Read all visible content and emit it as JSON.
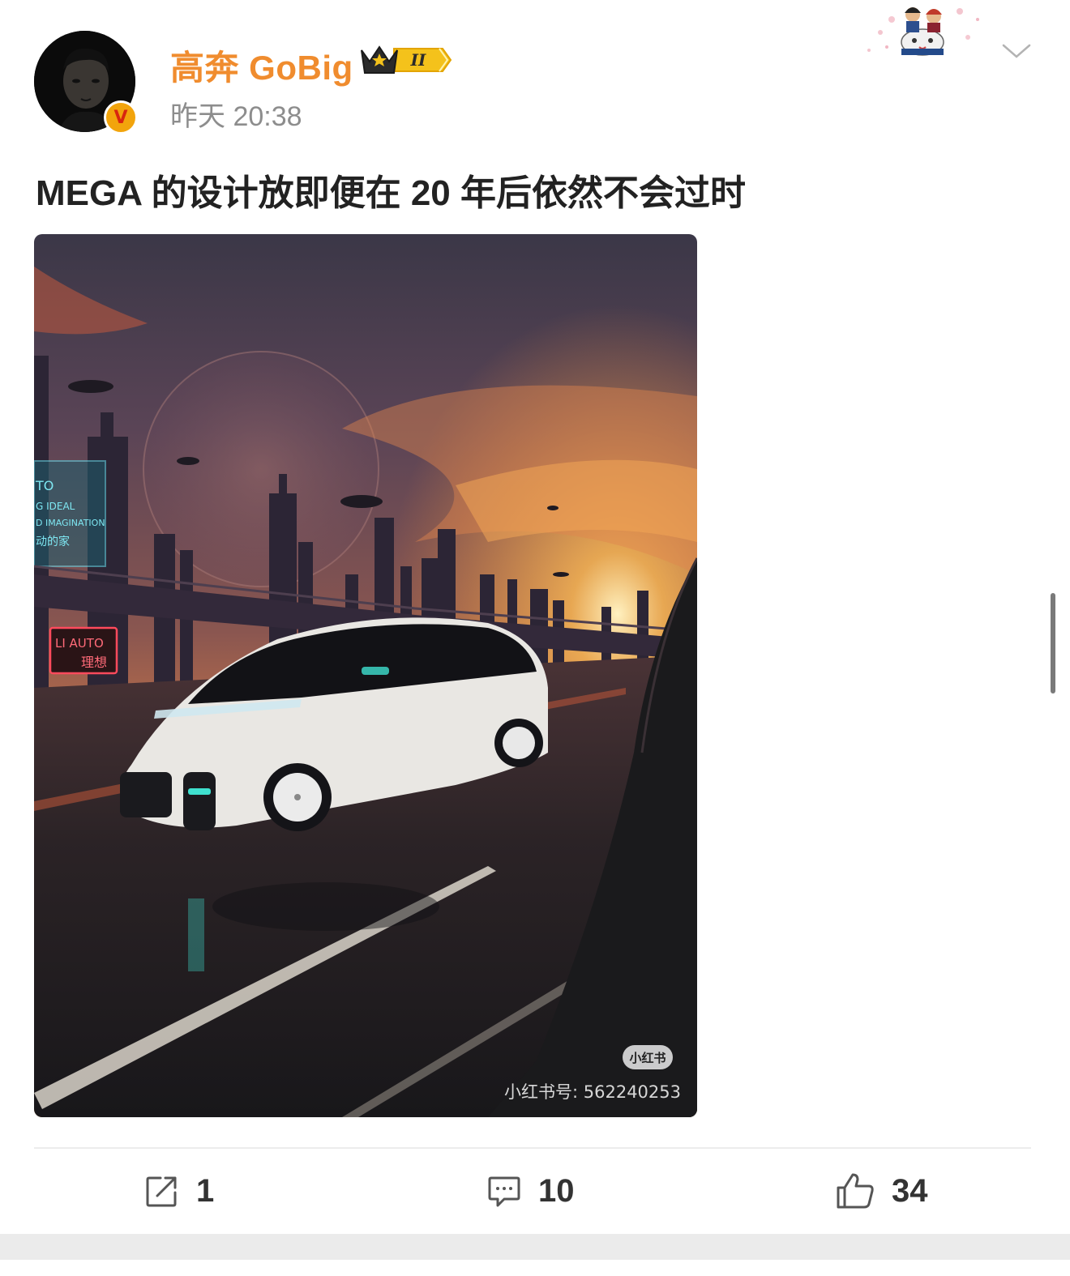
{
  "post": {
    "author": {
      "name": "高奔 GoBig",
      "verified_mark": "V",
      "level_badge": "II"
    },
    "timestamp": "昨天 20:38",
    "text": "MEGA 的设计放即便在 20 年后依然不会过时",
    "image": {
      "sign_text": "LI AUTO",
      "sign_text_cn": "理想",
      "billboard_lines": [
        "TO",
        "G IDEAL",
        "D IMAGINATION",
        "动的家"
      ],
      "watermark_badge": "小红书",
      "watermark_id": "小红书号: 562240253"
    },
    "actions": {
      "repost_count": "1",
      "comment_count": "10",
      "like_count": "34"
    }
  },
  "colors": {
    "username": "#f08c2e",
    "timestamp": "#8d8d8d",
    "verified_badge": "#f2a40c",
    "text": "#222222"
  }
}
